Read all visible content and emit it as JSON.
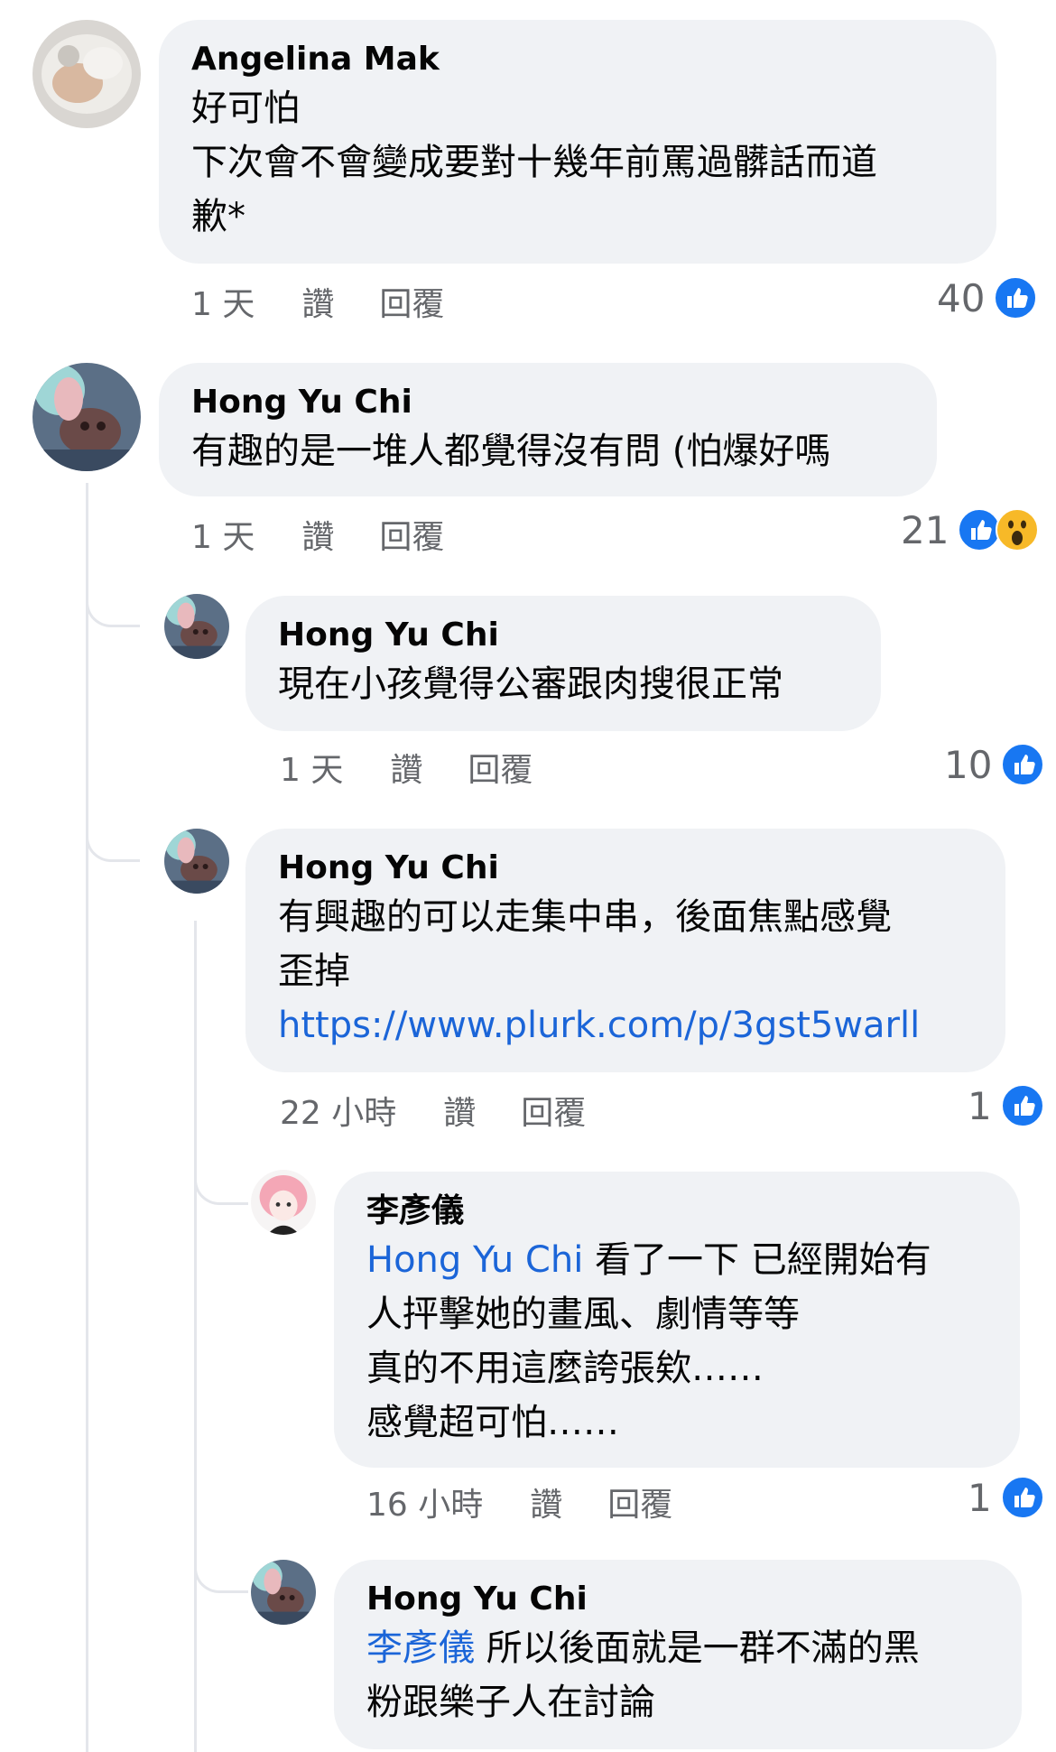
{
  "comments": [
    {
      "author": "Angelina Mak",
      "text": "好可怕\n下次會不會變成要對十幾年前罵過髒話而道\n歉*",
      "time": "1 天",
      "like": "讚",
      "reply": "回覆",
      "reaction_count": "40"
    },
    {
      "author": "Hong Yu Chi",
      "text": "有趣的是一堆人都覺得沒有問 (怕爆好嗎",
      "time": "1 天",
      "like": "讚",
      "reply": "回覆",
      "reaction_count": "21"
    },
    {
      "author": "Hong Yu Chi",
      "text": "現在小孩覺得公審跟肉搜很正常",
      "time": "1 天",
      "like": "讚",
      "reply": "回覆",
      "reaction_count": "10"
    },
    {
      "author": "Hong Yu Chi",
      "text": "有興趣的可以走集中串，後面焦點感覺\n歪掉",
      "link": "https://www.plurk.com/p/3gst5warll",
      "time": "22 小時",
      "like": "讚",
      "reply": "回覆",
      "reaction_count": "1"
    },
    {
      "author": "李彥儀",
      "mention": "Hong Yu Chi",
      "text": " 看了一下 已經開始有\n人抨擊她的畫風、劇情等等\n真的不用這麼誇張欸……\n感覺超可怕……",
      "time": "16 小時",
      "like": "讚",
      "reply": "回覆",
      "reaction_count": "1"
    },
    {
      "author": "Hong Yu Chi",
      "mention": "李彥儀",
      "text": " 所以後面就是一群不滿的黑\n粉跟樂子人在討論"
    }
  ],
  "colors": {
    "bubble_bg": "#f0f2f5",
    "link": "#1b65d8",
    "meta_text": "#65676b",
    "like_blue": "#1877f2",
    "wow_yellow": "#f7b928",
    "thread_line": "#e4e6eb"
  },
  "icons": {
    "like_reaction": "thumbs-up-icon",
    "wow_reaction": "wow-face-icon"
  }
}
